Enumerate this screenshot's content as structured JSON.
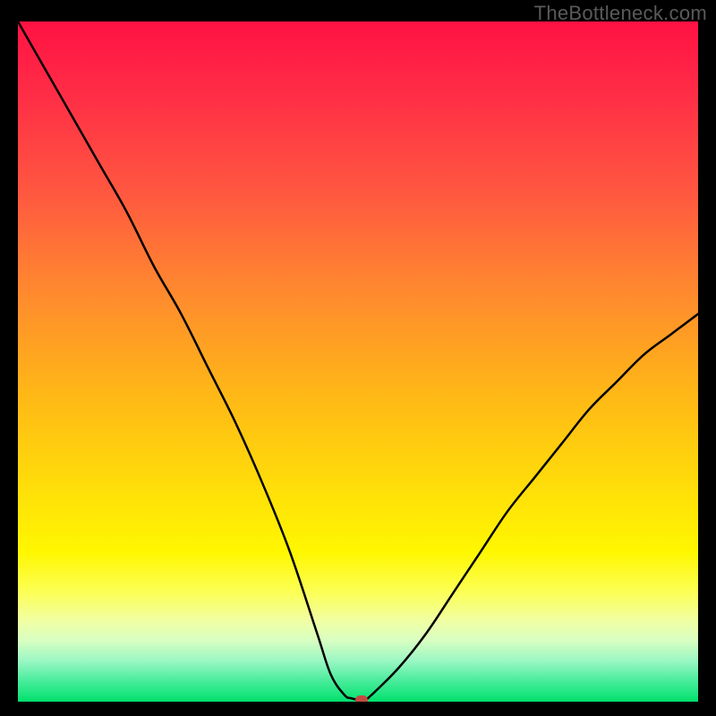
{
  "watermark": "TheBottleneck.com",
  "chart_data": {
    "type": "line",
    "title": "",
    "xlabel": "",
    "ylabel": "",
    "xlim": [
      0,
      100
    ],
    "ylim": [
      0,
      100
    ],
    "x": [
      0,
      4,
      8,
      12,
      16,
      20,
      24,
      28,
      32,
      36,
      40,
      44,
      46,
      48,
      49,
      50,
      51,
      52,
      56,
      60,
      64,
      68,
      72,
      76,
      80,
      84,
      88,
      92,
      96,
      100
    ],
    "values": [
      100,
      93,
      86,
      79,
      72,
      64,
      57,
      49,
      41,
      32,
      22,
      10,
      4,
      1,
      0.5,
      0.3,
      0.3,
      1,
      5,
      10,
      16,
      22,
      28,
      33,
      38,
      43,
      47,
      51,
      54,
      57
    ],
    "marker": {
      "x": 50.5,
      "y": 0.3
    },
    "legend": [],
    "grid": false
  },
  "colors": {
    "curve": "#000000",
    "marker": "#c24b40",
    "gradient_top": "#ff1243",
    "gradient_bottom": "#00df6a"
  }
}
